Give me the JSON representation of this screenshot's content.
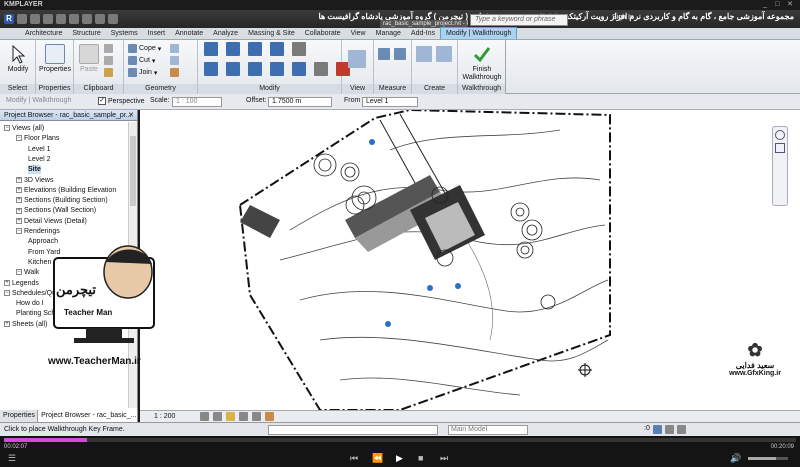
{
  "player": {
    "logo": "KMPLAYER",
    "window_controls": "_ □ ✕",
    "time_current": "00:02:07",
    "time_total": "00:20:09",
    "progress": 0.105
  },
  "title_bar": {
    "persian_title": "مجموعه آموزشی جامع ، گام به گام و کاربردی نرم افزار رویت آرکیتکچر ۲۰۱۶   مدرس : سعید فدایی ( تیچرمن ) گروه آموزشی پادشاه گرافیست ها",
    "document_tab": "rac_basic_sample_project.rvt - Plan: Site",
    "search_placeholder": "Type a keyword or phrase",
    "sign_in": "Sign In"
  },
  "tabs": [
    "Architecture",
    "Structure",
    "Systems",
    "Insert",
    "Annotate",
    "Analyze",
    "Massing & Site",
    "Collaborate",
    "View",
    "Manage",
    "Add-Ins",
    "Modify | Walkthrough"
  ],
  "ribbon": {
    "panels": {
      "select": "Select",
      "properties": "Properties",
      "clipboard": "Clipboard",
      "geometry": "Geometry",
      "modify": "Modify",
      "view": "View",
      "measure": "Measure",
      "create": "Create",
      "walkthrough": "Walkthrough"
    },
    "modify_button": "Modify",
    "properties_button": "Properties",
    "paste_button": "Paste",
    "cope": "Cope",
    "cut": "Cut",
    "join": "Join",
    "finish_walkthrough": "Finish Walkthrough"
  },
  "options_bar": {
    "context": "Modify | Walkthrough",
    "perspective_label": "Perspective",
    "scale_label": "Scale:",
    "scale_value": "1 : 100",
    "offset_label": "Offset:",
    "offset_value": "1.7500 m",
    "from_label": "From",
    "from_value": "Level 1"
  },
  "project_browser": {
    "title": "Project Browser - rac_basic_sample_pr...",
    "tree": [
      {
        "label": "Views (all)",
        "indent": 0,
        "exp": "−"
      },
      {
        "label": "Floor Plans",
        "indent": 1,
        "exp": "−"
      },
      {
        "label": "Level 1",
        "indent": 2,
        "exp": ""
      },
      {
        "label": "Level 2",
        "indent": 2,
        "exp": ""
      },
      {
        "label": "Site",
        "indent": 2,
        "exp": "",
        "bold": true
      },
      {
        "label": "3D Views",
        "indent": 1,
        "exp": "+"
      },
      {
        "label": "Elevations (Building Elevation",
        "indent": 1,
        "exp": "+"
      },
      {
        "label": "Sections (Building Section)",
        "indent": 1,
        "exp": "+"
      },
      {
        "label": "Sections (Wall Section)",
        "indent": 1,
        "exp": "+"
      },
      {
        "label": "Detail Views (Detail)",
        "indent": 1,
        "exp": "+"
      },
      {
        "label": "Renderings",
        "indent": 1,
        "exp": "−"
      },
      {
        "label": "Approach",
        "indent": 2,
        "exp": ""
      },
      {
        "label": "From Yard",
        "indent": 2,
        "exp": ""
      },
      {
        "label": "Kitchen",
        "indent": 2,
        "exp": ""
      },
      {
        "label": "Walk",
        "indent": 1,
        "exp": "−"
      },
      {
        "label": "Legends",
        "indent": 0,
        "exp": "+"
      },
      {
        "label": "Schedules/Quantities",
        "indent": 0,
        "exp": "−"
      },
      {
        "label": "How do I",
        "indent": 1,
        "exp": ""
      },
      {
        "label": "Planting Schedule",
        "indent": 1,
        "exp": ""
      },
      {
        "label": "Sheets (all)",
        "indent": 0,
        "exp": "+"
      }
    ],
    "tabs": [
      "Properties",
      "Project Browser - rac_basic_..."
    ]
  },
  "view_control": {
    "scale": "1 : 200",
    "model": "Main Model",
    "coord_value": ":0"
  },
  "status": {
    "message": "Click to place Walkthrough Key Frame."
  },
  "overlays": {
    "teacherman_fa": "تیچرمن",
    "teacherman_en": "Teacher Man",
    "teacherman_url": "www.TeacherMan.ir",
    "gfxking_fa": "سعید فدایی",
    "gfxking_url": "www.GfxKing.ir"
  },
  "colors": {
    "accent": "#a9d3ee",
    "seek": "#d04cd8",
    "ribbon_bg": "#eef1f4"
  }
}
